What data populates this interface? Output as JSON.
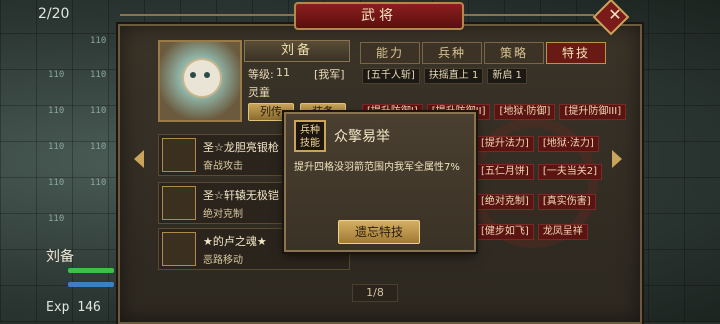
{
  "background": {
    "turn": "2/20",
    "hero_name": "刘备",
    "exp": "Exp 146",
    "tile_values": [
      "110",
      "110",
      "110",
      "110",
      "110",
      "110",
      "110",
      "110",
      "110",
      "110"
    ]
  },
  "dialog": {
    "title": "武将",
    "hero": {
      "name": "刘备",
      "level_label": "等级:",
      "level": "11",
      "faction": "[我军]",
      "type": "灵童",
      "btn_bio": "列传",
      "btn_equip": "装备"
    },
    "tabs": [
      {
        "label": "能力",
        "active": false
      },
      {
        "label": "兵种",
        "active": false
      },
      {
        "label": "策略",
        "active": false
      },
      {
        "label": "特技",
        "active": true
      }
    ],
    "tag_rows": [
      [
        "[五千人斩]",
        "扶摇直上 1",
        "新启 1"
      ],
      [
        "[提升防御I]",
        "[提升防御II]",
        "[地狱·防御]",
        "[提升防御III]"
      ],
      [
        "[提升法力]",
        "[地狱·法力]"
      ],
      [
        "[五仁月饼]",
        "[一夫当关2]"
      ],
      [
        "[绝对克制]",
        "[真实伤害]"
      ],
      [
        "[健步如飞]",
        "龙凤呈祥"
      ]
    ],
    "skills": [
      {
        "name": "圣☆龙胆亮银枪",
        "type": "奋战攻击"
      },
      {
        "name": "圣☆轩辕无极铠",
        "type": "绝对克制"
      },
      {
        "name": "★的卢之魂★",
        "type": "恶路移动"
      }
    ],
    "pager": "1/8",
    "popup": {
      "badge": "兵种技能",
      "title": "众擎易举",
      "desc": "提升四格没羽箭范围内我军全属性7%",
      "btn": "遗忘特技"
    }
  }
}
